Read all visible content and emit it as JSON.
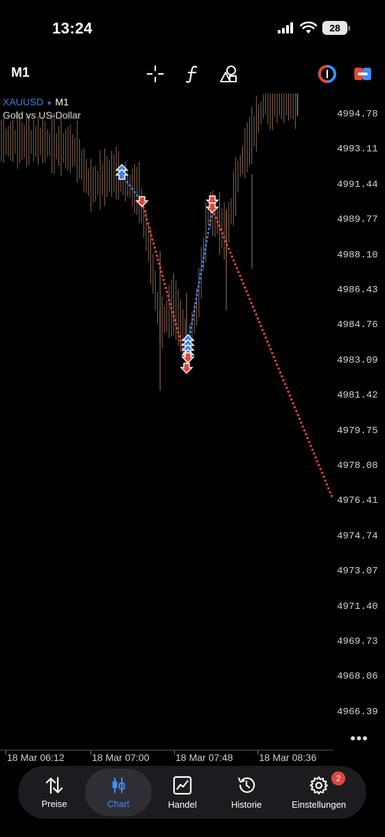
{
  "status": {
    "time": "13:24",
    "battery": "28"
  },
  "toolbar": {
    "timeframe": "M1"
  },
  "symbol": {
    "name": "XAUUSD",
    "timeframe": "M1",
    "description": "Gold vs US-Dollar"
  },
  "price_axis": [
    "4994.78",
    "4993.11",
    "4991.44",
    "4989.77",
    "4988.10",
    "4986.43",
    "4984.76",
    "4983.09",
    "4981.42",
    "4979.75",
    "4978.08",
    "4976.41",
    "4974.74",
    "4973.07",
    "4971.40",
    "4969.73",
    "4968.06",
    "4966.39"
  ],
  "time_axis": [
    "18 Mar 06:12",
    "18 Mar 07:00",
    "18 Mar 07:48",
    "18 Mar 08:36"
  ],
  "colors": {
    "buy": "#3b82f6",
    "sell": "#e0483a",
    "accent": "#3f8cff",
    "candle": "#8a6a55"
  },
  "nav": {
    "items": [
      {
        "label": "Preise",
        "icon": "arrows-updown-icon"
      },
      {
        "label": "Chart",
        "icon": "candles-icon"
      },
      {
        "label": "Handel",
        "icon": "trade-chart-icon"
      },
      {
        "label": "Historie",
        "icon": "history-icon"
      },
      {
        "label": "Einstellungen",
        "icon": "gear-icon"
      }
    ],
    "badge": "2"
  }
}
